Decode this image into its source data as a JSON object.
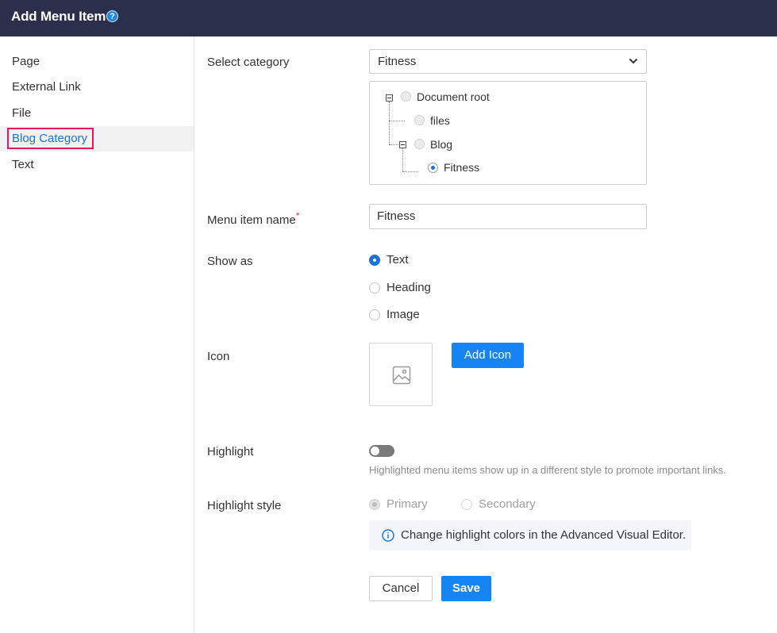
{
  "dialog": {
    "title": "Add Menu Item",
    "help_glyph": "?"
  },
  "sidebar": {
    "items": [
      {
        "label": "Page"
      },
      {
        "label": "External Link"
      },
      {
        "label": "File"
      },
      {
        "label": "Blog Category",
        "active": true
      },
      {
        "label": "Text"
      }
    ]
  },
  "form": {
    "category": {
      "label": "Select category",
      "selected": "Fitness",
      "tree": [
        {
          "label": "Document root",
          "expanded": true
        },
        {
          "label": "files"
        },
        {
          "label": "Blog",
          "expanded": true
        },
        {
          "label": "Fitness",
          "selected": true
        }
      ]
    },
    "menu_item_name": {
      "label": "Menu item name",
      "required_mark": "*",
      "value": "Fitness"
    },
    "show_as": {
      "label": "Show as",
      "options": [
        {
          "label": "Text",
          "checked": true
        },
        {
          "label": "Heading",
          "checked": false
        },
        {
          "label": "Image",
          "checked": false
        }
      ]
    },
    "icon": {
      "label": "Icon",
      "add_button": "Add Icon",
      "placeholder_icon": "image-icon"
    },
    "highlight": {
      "label": "Highlight",
      "enabled": false,
      "help": "Highlighted menu items show up in a different style to promote important links."
    },
    "highlight_style": {
      "label": "Highlight style",
      "options": [
        {
          "label": "Primary",
          "checked": true,
          "disabled": true
        },
        {
          "label": "Secondary",
          "checked": false,
          "disabled": true
        }
      ],
      "info": "Change highlight colors in the Advanced Visual Editor.",
      "info_icon": "info-icon"
    }
  },
  "actions": {
    "cancel": "Cancel",
    "save": "Save"
  },
  "colors": {
    "titlebar": "#2b2f4b",
    "accent": "#1585f5",
    "active_outline": "#e8175d",
    "link": "#1a73d9"
  }
}
